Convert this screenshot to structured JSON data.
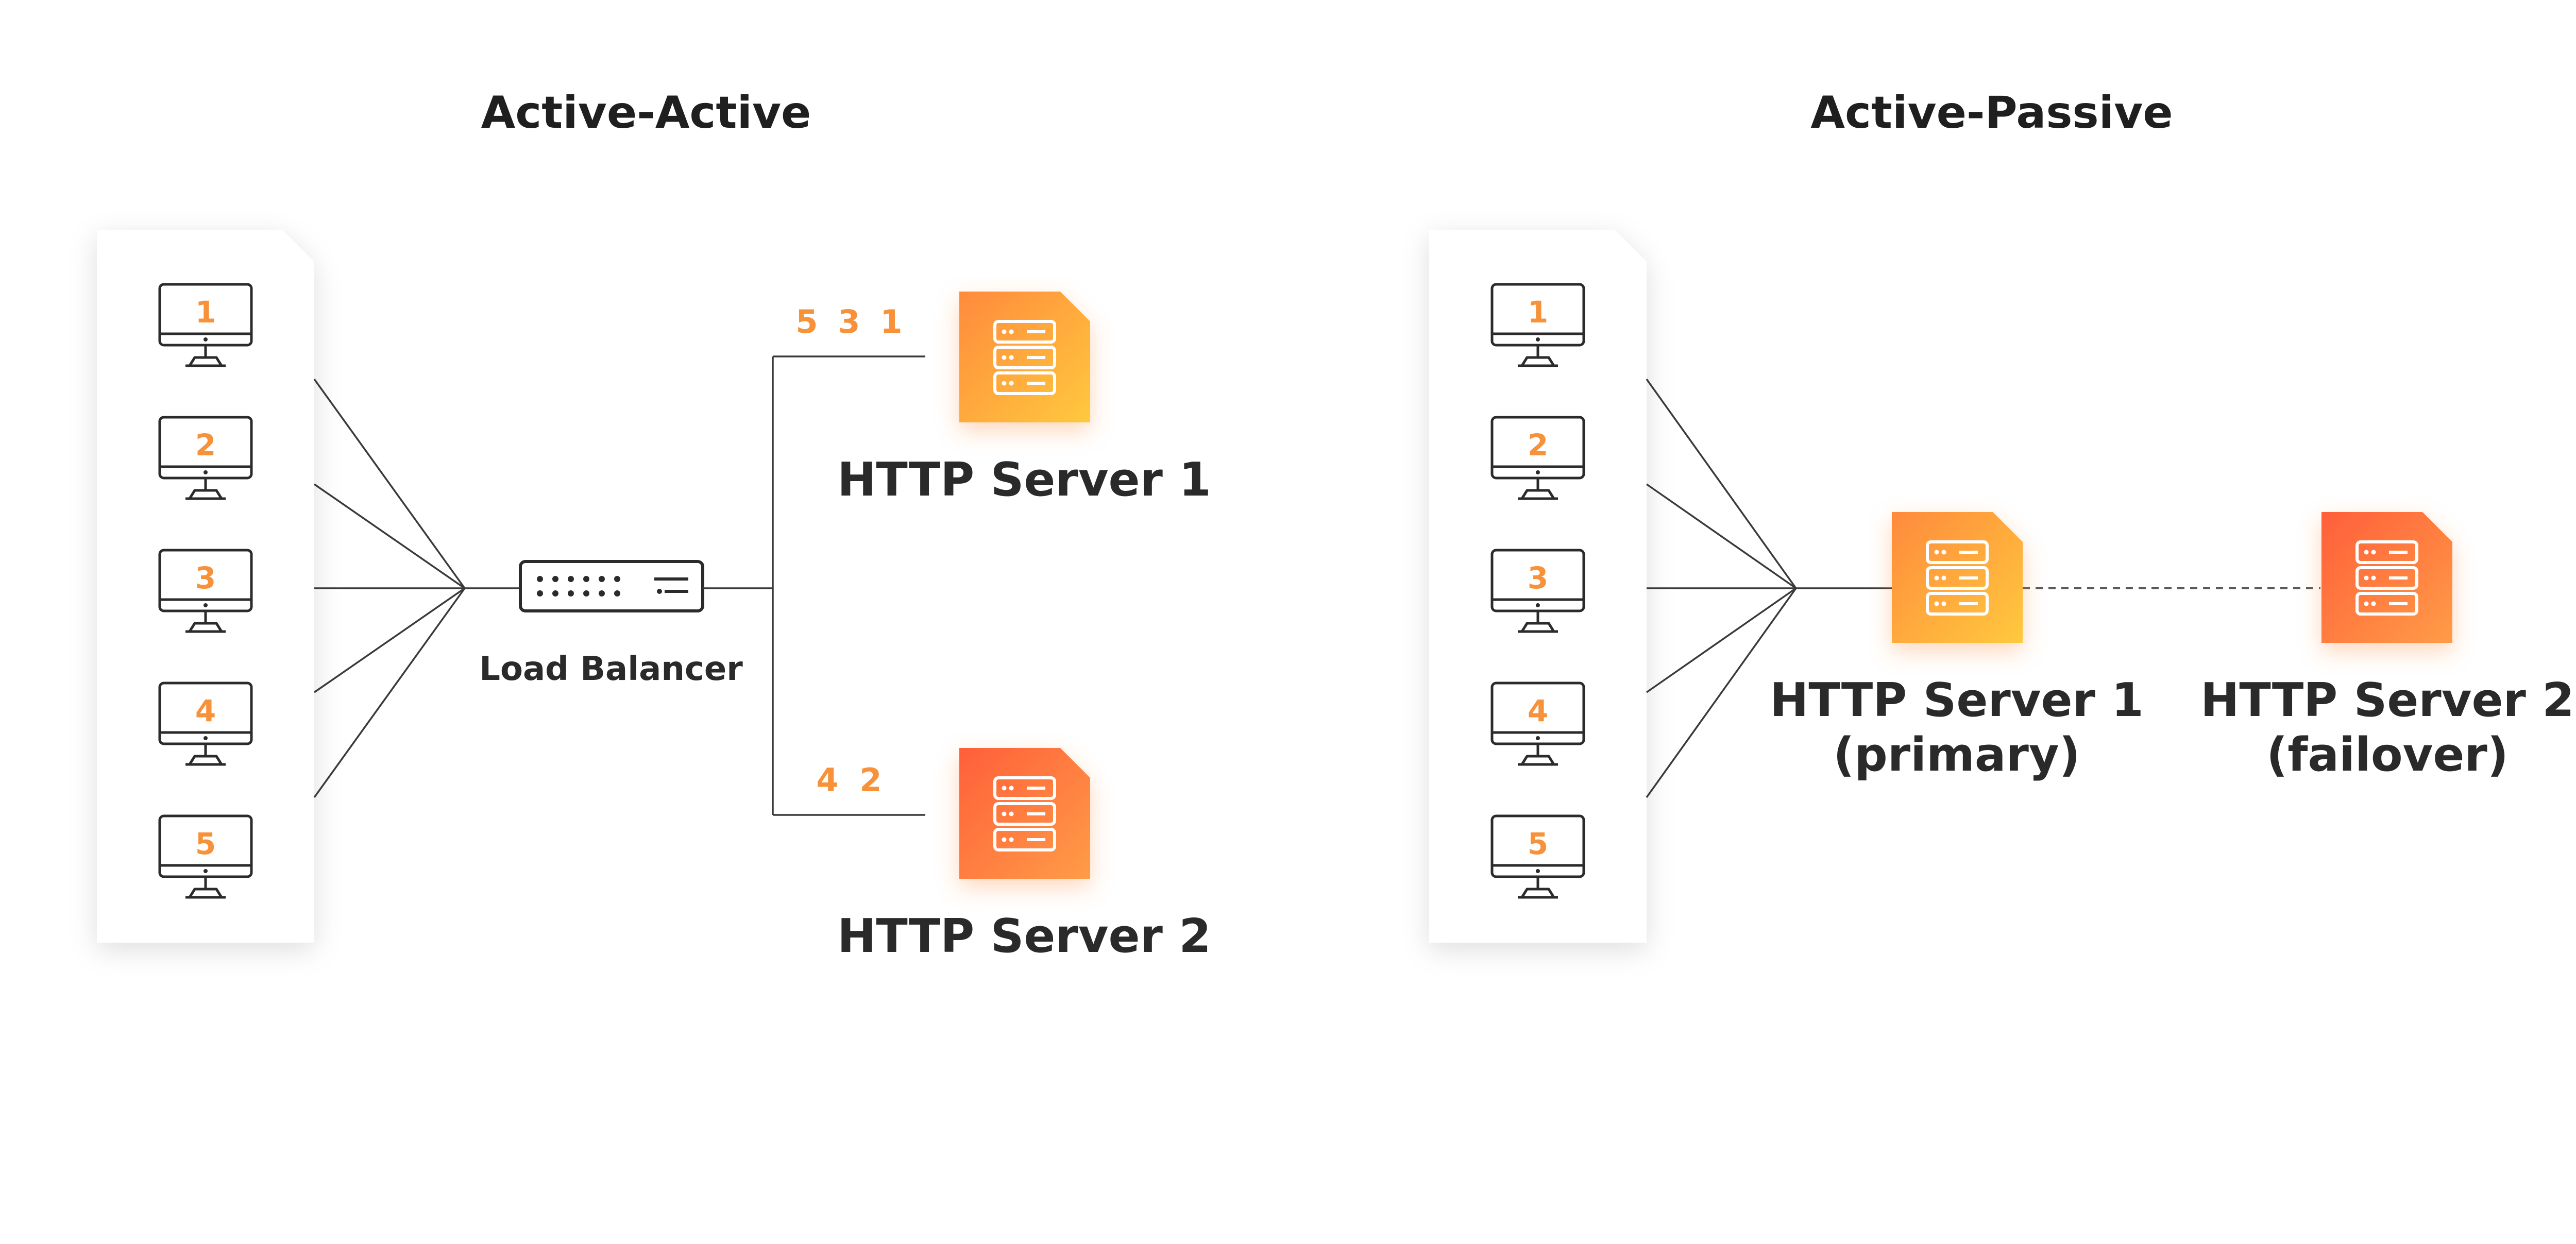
{
  "colors": {
    "accent_orange": "#f7923a",
    "server_yellow_gradient": [
      "#ff8a3d",
      "#ffc93c"
    ],
    "server_red_gradient": [
      "#ff6a3d",
      "#ff9a45"
    ],
    "line": "#3a3a3a",
    "panel": "#ffffff"
  },
  "active_active": {
    "title": "Active-Active",
    "clients": [
      "1",
      "2",
      "3",
      "4",
      "5"
    ],
    "load_balancer": {
      "label": "Load Balancer",
      "icon": "network-switch-icon"
    },
    "servers": [
      {
        "label": "HTTP Server 1",
        "queue": [
          "5",
          "3",
          "1"
        ],
        "icon": "server-rack-icon"
      },
      {
        "label": "HTTP Server 2",
        "queue": [
          "4",
          "2"
        ],
        "icon": "server-rack-icon"
      }
    ]
  },
  "active_passive": {
    "title": "Active-Passive",
    "clients": [
      "1",
      "2",
      "3",
      "4",
      "5"
    ],
    "servers": [
      {
        "label_line1": "HTTP Server 1",
        "label_line2": "(primary)",
        "icon": "server-rack-icon"
      },
      {
        "label_line1": "HTTP Server 2",
        "label_line2": "(failover)",
        "icon": "server-rack-icon"
      }
    ]
  }
}
